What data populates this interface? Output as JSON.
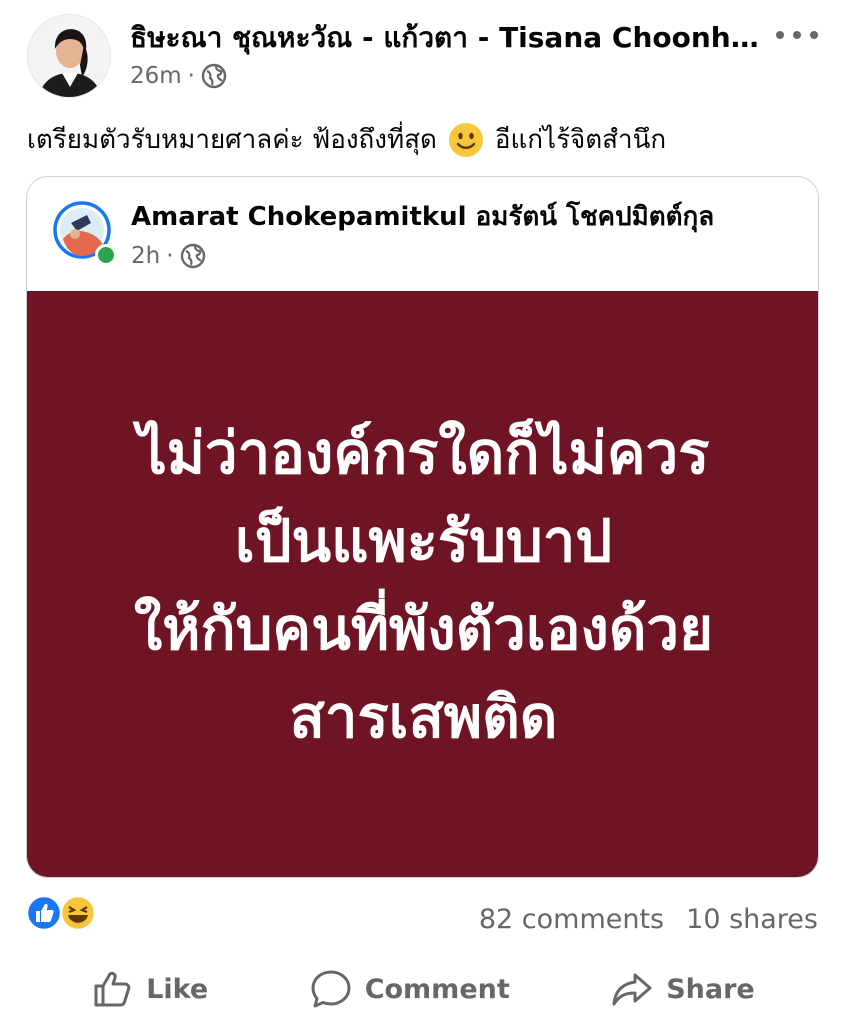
{
  "post": {
    "author_name": "ธิษะณา ชุณหะวัณ - แก้วตา - Tisana Choonhavan",
    "time": "26m",
    "privacy_icon": "globe-icon",
    "caption_before_emoji": "เตรียมตัวรับหมายศาลค่ะ ฟ้องถึงที่สุด",
    "caption_emoji": "slightly-smiling-face",
    "caption_after_emoji": "อีแก่ไร้จิตสำนึก"
  },
  "shared_post": {
    "author_name": "Amarat Chokepamitkul อมรัตน์ โชคปมิตต์กุล",
    "time": "2h",
    "privacy_icon": "globe-icon",
    "online": true,
    "quote_lines": [
      "ไม่ว่าองค์กรใดก็ไม่ควร",
      "เป็นแพะรับบาป",
      "ให้กับคนที่พังตัวเองด้วย",
      "สารเสพติด"
    ],
    "background_color": "#6f1424"
  },
  "engagement": {
    "reactions": [
      "like",
      "haha"
    ],
    "comments": "82 comments",
    "shares": "10 shares"
  },
  "actions": {
    "like_label": "Like",
    "comment_label": "Comment",
    "share_label": "Share"
  },
  "colors": {
    "like_blue": "#1877f2",
    "online_green": "#31a24c",
    "meta_gray": "#65676b"
  }
}
